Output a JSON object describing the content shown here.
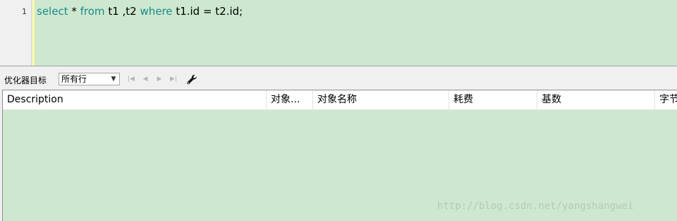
{
  "editor": {
    "line_number": "1",
    "code": {
      "t1": "select",
      "t2": " * ",
      "t3": "from",
      "t4": " t1 ,t2 ",
      "t5": "where",
      "t6": " t1.id = t2.id;"
    }
  },
  "toolbar": {
    "goal_label": "优化器目标",
    "goal_value": "所有行",
    "icons": [
      "first-icon",
      "prev-icon",
      "next-icon",
      "last-icon",
      "wrench-icon"
    ]
  },
  "grid": {
    "columns": [
      "Description",
      "对象...",
      "对象名称",
      "耗费",
      "基数",
      "字节"
    ]
  },
  "watermark": "http://blog.csdn.net/yangshangwei",
  "colors": {
    "editor_bg": "#cde8cf",
    "keyword": "#1a8a8a",
    "grid_bg": "#cde8cf"
  }
}
